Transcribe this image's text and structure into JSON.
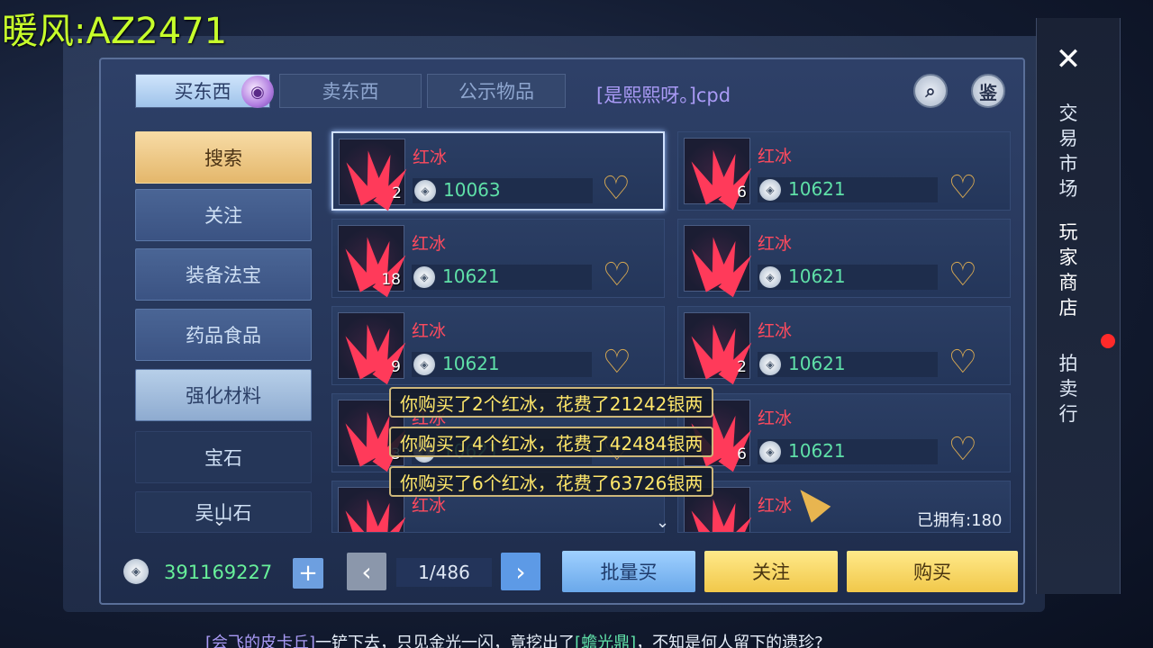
{
  "watermark": "暖风:AZ2471",
  "tabs": {
    "buy": "买东西",
    "sell": "卖东西",
    "public": "公示物品"
  },
  "announcement": "[是熙熙呀。]cpd",
  "top_buttons": {
    "search_icon": "search-doc-icon",
    "appraise": "鉴"
  },
  "sidebar": [
    {
      "label": "搜索",
      "style": "selected"
    },
    {
      "label": "关注",
      "style": "normal"
    },
    {
      "label": "装备法宝",
      "style": "normal"
    },
    {
      "label": "药品食品",
      "style": "normal"
    },
    {
      "label": "强化材料",
      "style": "light"
    },
    {
      "label": "宝石",
      "style": "plain"
    },
    {
      "label": "吴山石",
      "style": "plain"
    }
  ],
  "items": [
    {
      "name": "红冰",
      "qty": "2",
      "price": "10063",
      "selected": true
    },
    {
      "name": "红冰",
      "qty": "6",
      "price": "10621"
    },
    {
      "name": "红冰",
      "qty": "18",
      "price": "10621"
    },
    {
      "name": "红冰",
      "qty": "",
      "price": "10621"
    },
    {
      "name": "红冰",
      "qty": "9",
      "price": "10621"
    },
    {
      "name": "红冰",
      "qty": "2",
      "price": "10621"
    },
    {
      "name": "红冰",
      "qty": "3",
      "price": "10621"
    },
    {
      "name": "红冰",
      "qty": "6",
      "price": "10621"
    },
    {
      "name": "红冰",
      "qty": "",
      "price": ""
    },
    {
      "name": "红冰",
      "qty": "",
      "price": ""
    }
  ],
  "toasts": [
    "你购买了2个红冰，花费了21242银两",
    "你购买了4个红冰，花费了42484银两",
    "你购买了6个红冰，花费了63726银两"
  ],
  "owned": "已拥有:180",
  "bottom": {
    "money": "391169227",
    "plus": "+",
    "prev": "‹",
    "page": "1/486",
    "next": "›",
    "batch_buy": "批量买",
    "follow": "关注",
    "buy": "购买"
  },
  "right_menu": {
    "close": "✕",
    "trade_market": "交易市场",
    "player_shop": "玩家商店",
    "auction": "拍卖行"
  },
  "system_message": {
    "player": "[会飞的皮卡丘]",
    "text1": "一铲下去，只见金光一闪，竟挖出了",
    "item": "[蟾光鼎]",
    "text2": "，不知是何人留下的遗珍?"
  },
  "colors": {
    "item_name": "#ff4a5e",
    "price": "#5fe0a8",
    "toast_text": "#ffe76a",
    "money": "#67f09a"
  }
}
